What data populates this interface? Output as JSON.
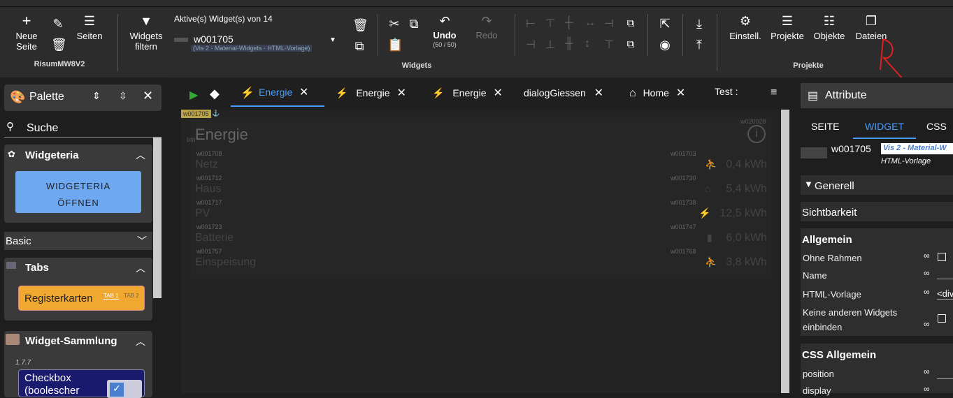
{
  "toolbar": {
    "new_page_line1": "Neue",
    "new_page_line2": "Seite",
    "pages": "Seiten",
    "project_name": "RisumMW8V2",
    "filter_line1": "Widgets",
    "filter_line2": "filtern",
    "active_widgets": "Aktive(s) Widget(s) von 14",
    "widget_id": "w001705",
    "widget_set": "(Vis 2 - Material-Widgets - HTML-Vorlage)",
    "undo": "Undo",
    "undo_count": "(50 / 50)",
    "redo": "Redo",
    "group_widgets": "Widgets",
    "settings": "Einstell.",
    "projects": "Projekte",
    "objects": "Objekte",
    "files": "Dateien",
    "group_projects": "Projekte"
  },
  "palette": {
    "title": "Palette",
    "search": "Suche",
    "widgeteria": "Widgeteria",
    "widgeteria_btn_line1": "WIDGETERIA",
    "widgeteria_btn_line2": "ÖFFNEN",
    "basic": "Basic",
    "tabs": "Tabs",
    "registerkarten": "Registerkarten",
    "tab1": "TAB 1",
    "tab2": "TAB 2",
    "sammlung": "Widget-Sammlung",
    "version": "1.7.7",
    "checkbox_line1": "Checkbox",
    "checkbox_line2": "(boolescher"
  },
  "view_tabs": [
    "Energie",
    "Energie",
    "Energie",
    "dialogGiessen",
    "Home",
    "Test :"
  ],
  "canvas": {
    "outer_tag": "w001705",
    "title": "Energie",
    "title_tag": "btn",
    "info_tag": "w020028",
    "rows": [
      {
        "tag": "w001708",
        "label": "Netz",
        "vtag": "w001703",
        "value": "0,4 kWh",
        "icon": "⛹"
      },
      {
        "tag": "w001712",
        "label": "Haus",
        "vtag": "w001730",
        "value": "5,4 kWh",
        "icon": "⌂"
      },
      {
        "tag": "w001717",
        "label": "PV",
        "vtag": "w001738",
        "value": "12,5 kWh",
        "icon": "⚡"
      },
      {
        "tag": "w001723",
        "label": "Batterie",
        "vtag": "w001747",
        "value": "6,0 kWh",
        "icon": "▮"
      },
      {
        "tag": "w001757",
        "label": "Einspeisung",
        "vtag": "w001768",
        "value": "3,8 kWh",
        "icon": "⛹"
      }
    ]
  },
  "attributes": {
    "title": "Attribute",
    "tab_page": "SEITE",
    "tab_widget": "WIDGET",
    "tab_css": "CSS",
    "widget_id": "w001705",
    "widget_set": "Vis 2 - Material-W",
    "widget_type": "HTML-Vorlage",
    "generell": "Generell",
    "sichtbarkeit": "Sichtbarkeit",
    "allgemein": "Allgemein",
    "ohne_rahmen": "Ohne Rahmen",
    "name": "Name",
    "html_vorlage": "HTML-Vorlage",
    "html_value": "<div",
    "keine_line1": "Keine anderen Widgets",
    "keine_line2": "einbinden",
    "css_allgemein": "CSS Allgemein",
    "position": "position",
    "display": "display"
  },
  "colors": {
    "accent": "#4a9eff",
    "annotation": "#e02020",
    "orange": "#f0a830",
    "blue_btn": "#6ea8f0"
  }
}
